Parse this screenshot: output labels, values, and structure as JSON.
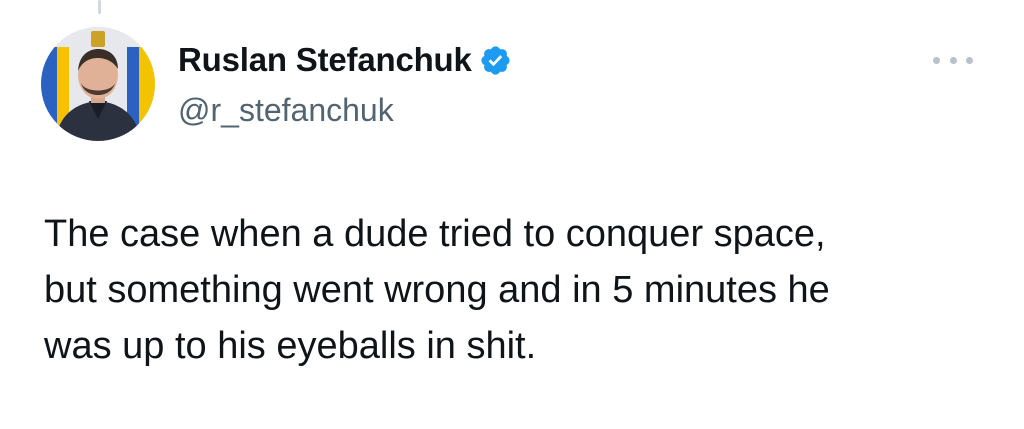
{
  "author": {
    "display_name": "Ruslan Stefanchuk",
    "handle": "@r_stefanchuk",
    "verified": true
  },
  "tweet": {
    "text": "The case when a dude tried to conquer space,\nbut something went wrong and in 5 minutes he\nwas up to his eyeballs in shit."
  },
  "colors": {
    "verified_badge": "#1d9bf0",
    "handle": "#536471",
    "text": "#0f1419",
    "more_dots": "#b8c2cb"
  },
  "icons": {
    "verified": "verified-badge-icon",
    "more": "more-options-icon"
  }
}
